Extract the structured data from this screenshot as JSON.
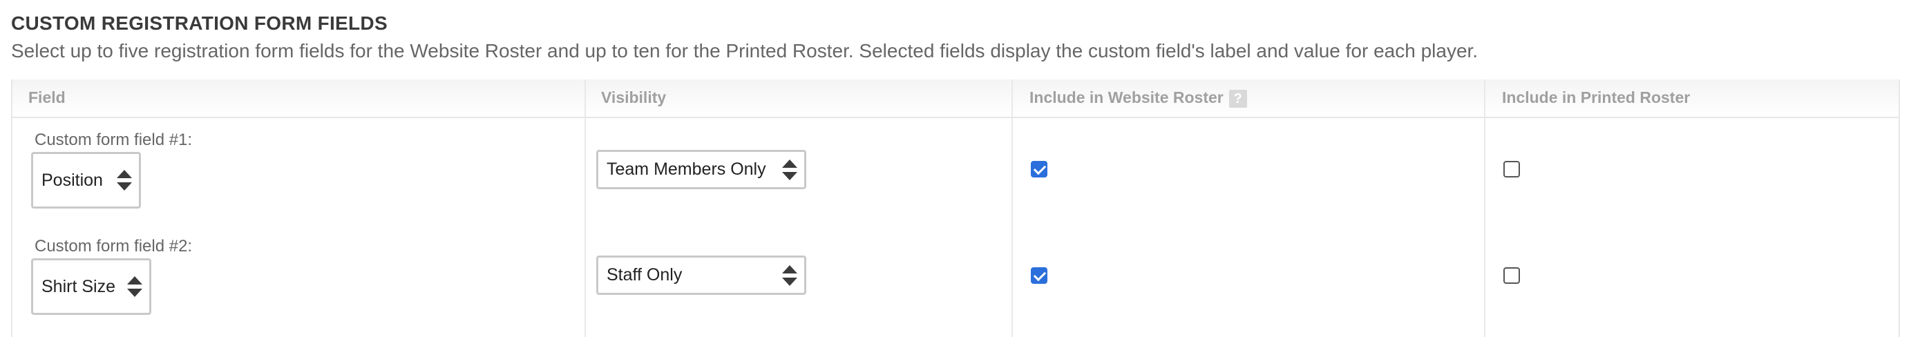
{
  "section": {
    "title": "CUSTOM REGISTRATION FORM FIELDS",
    "description": "Select up to five registration form fields for the Website Roster and up to ten for the Printed Roster. Selected fields display the custom field's label and value for each player."
  },
  "table": {
    "headers": {
      "field": "Field",
      "visibility": "Visibility",
      "website": "Include in Website Roster",
      "website_help": "?",
      "printed": "Include in Printed Roster"
    },
    "rows": [
      {
        "label": "Custom form field #1:",
        "field_value": "Position",
        "visibility_value": "Team Members Only",
        "include_website": true,
        "include_printed": false
      },
      {
        "label": "Custom form field #2:",
        "field_value": "Shirt Size",
        "visibility_value": "Staff Only",
        "include_website": true,
        "include_printed": false
      }
    ]
  },
  "colors": {
    "checkbox_checked": "#2a6fdb",
    "header_text": "#a0a0a0"
  }
}
